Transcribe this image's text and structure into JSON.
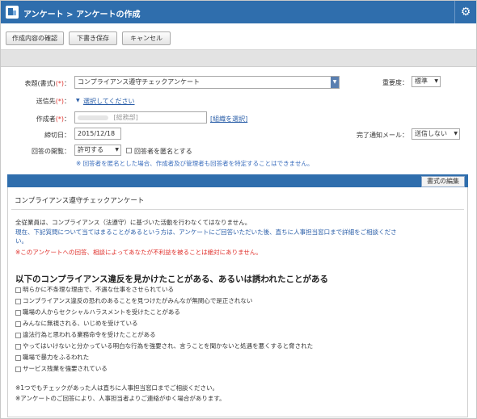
{
  "header": {
    "title": "アンケート > アンケートの作成"
  },
  "toolbar": {
    "confirm_label": "作成内容の確認",
    "draft_label": "下書き保存",
    "cancel_label": "キャンセル"
  },
  "form": {
    "title_label": "表題(書式)",
    "required_mark": "(*)",
    "title_value": "コンプライアンス遵守チェックアンケート",
    "importance_label": "重要度：",
    "importance_value": "標準",
    "recipients_label": "送信先",
    "recipients_link": "選択してください",
    "creator_label": "作成者",
    "creator_value": "[総務部]",
    "creator_link": "[組織を選択]",
    "deadline_label": "締切日：",
    "deadline_value": "2015/12/18",
    "completion_label": "完了通知メール：",
    "completion_value": "送信しない",
    "disclosure_label": "回答の開覧：",
    "disclosure_value": "許可する",
    "anonymous_label": "回答者を匿名とする",
    "anonymous_note": "※ 回答者を匿名とした場合、作成者及び管理者も回答者を特定することはできません。"
  },
  "panel": {
    "edit_button": "書式の編集",
    "survey_title": "コンプライアンス遵守チェックアンケート",
    "intro1": "全従業員は、コンプライアンス（法遵守）に基づいた活動を行わなくてはなりません。",
    "intro2a": "現在、下記質問について当てはまることがあるという方は、アンケートにご回答いただいた後、直ちに人事担当窓口まで詳細をご相談くださ",
    "intro2b": "い。",
    "intro3": "※このアンケートへの回答、相談によってあなたが不利益を被ることは絶対にありません。",
    "question": "以下のコンプライアンス違反を見かけたことがある、あるいは誘われたことがある",
    "options": [
      "明らかに不条理な理由で、不遇な仕事をさせられている",
      "コンプライアンス違反の恐れのあることを見つけたがみんなが無関心で是正されない",
      "職場の人からセクシャルハラスメントを受けたことがある",
      "みんなに無視される、いじめを受けている",
      "違法行為と思われる業務命令を受けたことがある",
      "やってはいけないと分かっている明白な行為を強要され、言うことを聞かないと処遇を悪くすると脅された",
      "職場で暴力をふるわれた",
      "サービス残業を強要されている"
    ],
    "footer1": "※1つでもチェックがあった人は直ちに人事担当窓口までご相談ください。",
    "footer2": "※アンケートのご回答により、人事担当者よりご連絡がゆく場合があります。"
  }
}
